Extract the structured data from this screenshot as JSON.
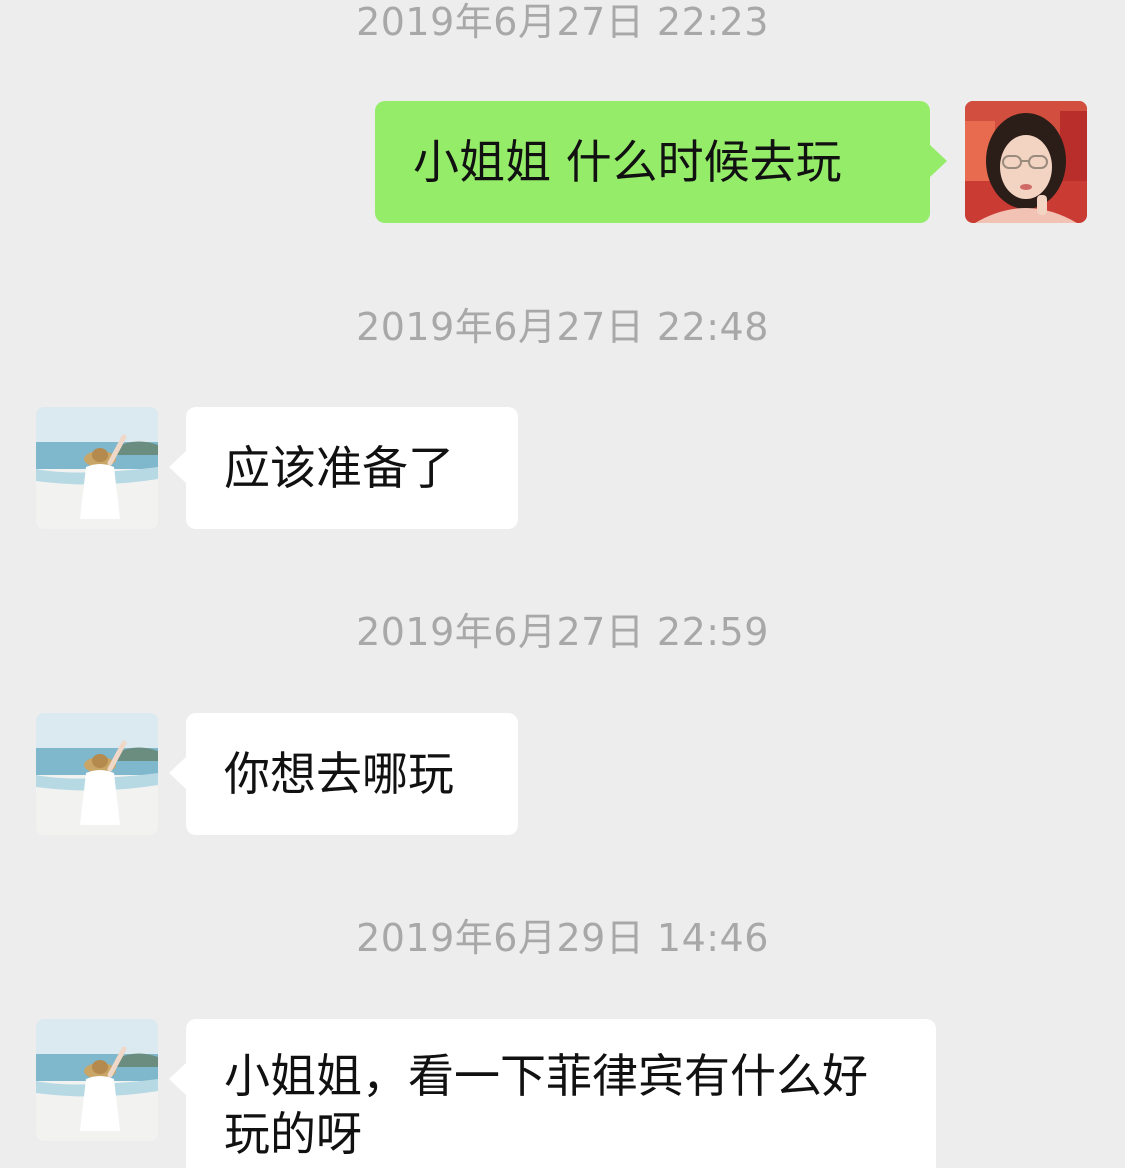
{
  "colors": {
    "background": "#ededed",
    "sent_bubble": "#95ec69",
    "received_bubble": "#ffffff",
    "timestamp_text": "#a8a8a8"
  },
  "messages": [
    {
      "timestamp": "2019年6月27日 22:23",
      "direction": "sent",
      "text": "小姐姐 什么时候去玩",
      "avatar": "self-portrait-avatar-icon"
    },
    {
      "timestamp": "2019年6月27日 22:48",
      "direction": "received",
      "text": "应该准备了",
      "avatar": "beach-avatar-icon"
    },
    {
      "timestamp": "2019年6月27日 22:59",
      "direction": "received",
      "text": "你想去哪玩",
      "avatar": "beach-avatar-icon"
    },
    {
      "timestamp": "2019年6月29日 14:46",
      "direction": "received",
      "text": "小姐姐，看一下菲律宾有什么好玩的呀",
      "avatar": "beach-avatar-icon"
    }
  ]
}
